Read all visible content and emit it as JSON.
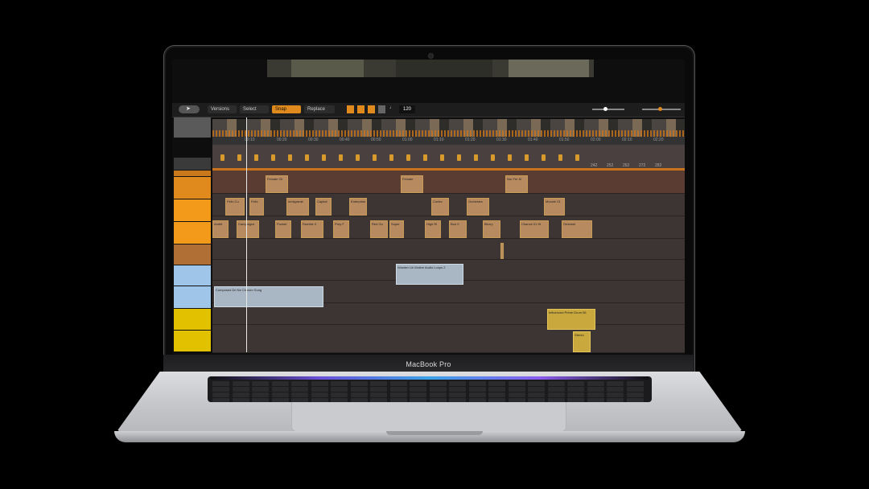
{
  "laptop": {
    "brand": "MacBook Pro"
  },
  "app": {
    "toolbar": {
      "mode_versions": "Versions",
      "mode_select": "Select",
      "mode_snap": "Snap",
      "mode_replace": "Replace",
      "tempo": "120",
      "accent": "#e08a1e"
    },
    "ruler_ticks": [
      "00:10",
      "00:20",
      "00:30",
      "00:40",
      "00:50",
      "01:00",
      "01:10",
      "01:20",
      "01:30",
      "01:40",
      "01:50",
      "02:00",
      "02:10",
      "02:20"
    ],
    "marker_numbers": [
      "242",
      "252",
      "262",
      "272",
      "282"
    ],
    "track_colors": [
      "#c9781c",
      "#e08a1e",
      "#f39a1a",
      "#f39a1a",
      "#b07035",
      "#9fc6e8",
      "#9fc6e8",
      "#e2c200",
      "#e2c200"
    ],
    "clips_row1": [
      "Female Cli",
      "Female",
      "Nor Fer M"
    ],
    "clips_row2": [
      "Felix Cu",
      "Felix",
      "Inmigrante",
      "Capital",
      "Enterprise",
      "Cortex",
      "Orchestra",
      "Moonie 01"
    ],
    "clips_row3": [
      "Ambit",
      "Campaigns",
      "Pocket",
      "Rumble 0",
      "Prey F",
      "Red Ou",
      "Super",
      "High Ri",
      "Boo 0",
      "Blurry",
      "Chance 01 Hi",
      "Ominiati"
    ],
    "clip_blue1": "Wonder Lik Motive Audio Loops 2",
    "clip_blue2": "Composed Dri Ne Chosen Song",
    "clip_yel1": "Influenced Prime Drum 06",
    "clip_yel2": "Stereo"
  }
}
